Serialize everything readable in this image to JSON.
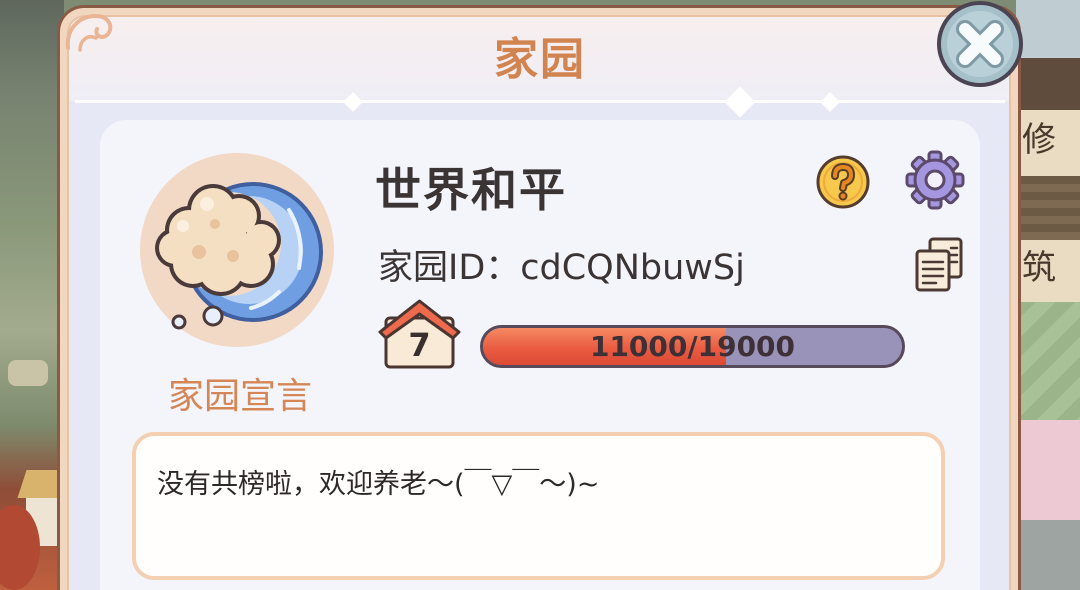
{
  "panel": {
    "title": "家园",
    "close_icon": "close-icon",
    "ornament_icon": "corner-ornament-icon"
  },
  "profile": {
    "avatar_icon": "cloud-wave-icon",
    "declaration_label": "家园宣言",
    "name": "世界和平",
    "id_label": "家园ID：",
    "id_value": "cdCQNbuwSj",
    "help_icon": "question-mark-icon",
    "settings_icon": "gear-icon",
    "copy_icon": "copy-icon"
  },
  "level": {
    "badge_icon": "house-icon",
    "value": "7",
    "progress_text": "11000/19000",
    "progress_fraction": 0.579
  },
  "declaration": {
    "text": "没有共榜啦，欢迎养老～(￣▽￣～)~"
  },
  "background": {
    "side_labels": [
      "修",
      "筑"
    ]
  },
  "colors": {
    "title": "#d28450",
    "declaration_label": "#d58656",
    "text": "#3a3434",
    "panel_frame": "#8b5a45",
    "progress_fill": "#ea5b41",
    "progress_track": "#9993ba",
    "help_icon": "#f6c84c",
    "settings_icon": "#a596e0",
    "close_button": "#a6c0c9"
  }
}
